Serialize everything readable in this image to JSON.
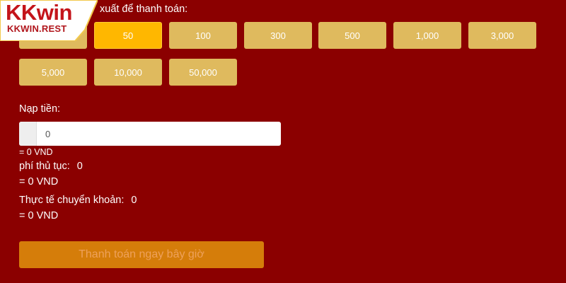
{
  "brand": {
    "logo_main_kk": "KK",
    "logo_main_win": "win",
    "logo_sub": "KKWIN.REST"
  },
  "section_title": "xuất để thanh toán:",
  "amounts": {
    "selected_index": 1,
    "items": [
      "",
      "50",
      "100",
      "300",
      "500",
      "1,000",
      "3,000",
      "5,000",
      "10,000",
      "50,000"
    ]
  },
  "deposit": {
    "label": "Nạp tiền:",
    "input_value": "0",
    "converted": "= 0 VND"
  },
  "fee": {
    "label": "phí thủ tục:",
    "value": "0",
    "converted": "= 0 VND"
  },
  "actual_transfer": {
    "label": "Thực tế chuyển khoản:",
    "value": "0",
    "converted": "= 0 VND"
  },
  "pay_button_label": "Thanh toán ngay bây giờ",
  "colors": {
    "background": "#8b0000",
    "amount_button": "#dfba5e",
    "amount_button_selected": "#ffb700",
    "pay_button": "#d57d0a",
    "pay_button_text": "#eea15b"
  }
}
